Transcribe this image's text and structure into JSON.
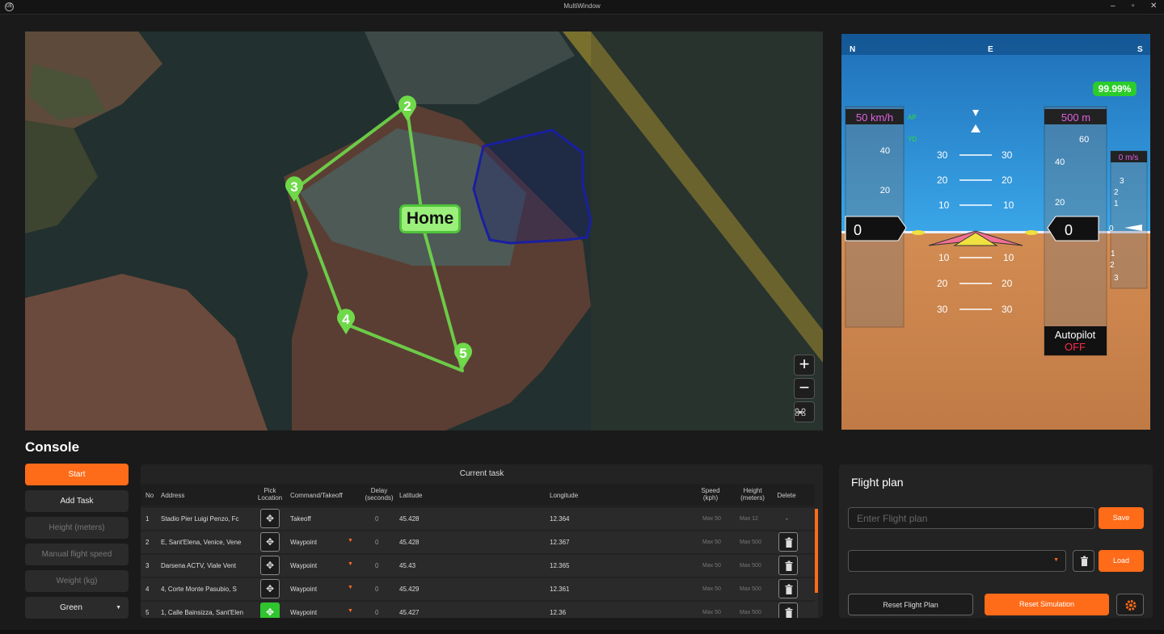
{
  "window": {
    "title": "MultiWindow",
    "logo": "UE",
    "minimize": "–",
    "maximize": "▫",
    "close": "✕"
  },
  "map": {
    "waypoints": [
      {
        "label": "2"
      },
      {
        "label": "3"
      },
      {
        "label": "4"
      },
      {
        "label": "5"
      }
    ],
    "home_label": "Home",
    "zoom_in": "+",
    "zoom_out": "−",
    "recenter_icon": "drone-icon"
  },
  "pfd": {
    "compass": [
      "N",
      "E",
      "S"
    ],
    "battery": "99.99%",
    "speed_readout": "50 km/h",
    "altitude_readout": "500 m",
    "vertical_speed_readout": "0 m/s",
    "ap_flag": "AP",
    "yd_flag": "YD",
    "speed_value": "0",
    "altitude_value": "0",
    "speed_ticks": [
      "40",
      "20"
    ],
    "altitude_ticks": [
      "60",
      "40",
      "20"
    ],
    "vs_ticks_up": [
      "3",
      "2",
      "1"
    ],
    "vs_zero": "0",
    "vs_ticks_down": [
      "1",
      "2",
      "3"
    ],
    "pitch_up": [
      "30",
      "20",
      "10"
    ],
    "pitch_down": [
      "10",
      "20",
      "30"
    ],
    "autopilot_label": "Autopilot",
    "autopilot_state": "OFF",
    "sky_color": "#3aa6e8",
    "ground_color": "#c98550"
  },
  "console": {
    "title": "Console",
    "buttons": {
      "start": "Start",
      "add_task": "Add Task",
      "height": "Height (meters)",
      "manual_speed": "Manual flight speed",
      "weight": "Weight (kg)",
      "color": "Green"
    }
  },
  "task": {
    "title": "Current task",
    "headers": {
      "no": "No",
      "address": "Address",
      "pick1": "Pick",
      "pick2": "Location",
      "command": "Command/Takeoff",
      "delay1": "Delay",
      "delay2": "(seconds)",
      "lat": "Latitude",
      "lon": "Longitude",
      "speed1": "Speed",
      "speed2": "(kph)",
      "height1": "Height",
      "height2": "(meters)",
      "delete": "Delete"
    },
    "rows": [
      {
        "no": "1",
        "address": "Stadio Pier Luigi Penzo, Fc",
        "command": "Takeoff",
        "delay": "0",
        "lat": "45.428",
        "lon": "12.364",
        "speed": "Max 50",
        "height": "Max 12",
        "del": "-"
      },
      {
        "no": "2",
        "address": "E, Sant'Elena, Venice, Vene",
        "command": "Waypoint",
        "delay": "0",
        "lat": "45.428",
        "lon": "12.367",
        "speed": "Max 50",
        "height": "Max 500",
        "del": ""
      },
      {
        "no": "3",
        "address": "Darsena ACTV, Viale Vent",
        "command": "Waypoint",
        "delay": "0",
        "lat": "45.43",
        "lon": "12.365",
        "speed": "Max 50",
        "height": "Max 500",
        "del": ""
      },
      {
        "no": "4",
        "address": "4, Corte Monte Pasubio, S",
        "command": "Waypoint",
        "delay": "0",
        "lat": "45.429",
        "lon": "12.361",
        "speed": "Max 50",
        "height": "Max 500",
        "del": ""
      },
      {
        "no": "5",
        "address": "1, Calle Bainsizza, Sant'Elen",
        "command": "Waypoint",
        "delay": "0",
        "lat": "45.427",
        "lon": "12.36",
        "speed": "Max 50",
        "height": "Max 500",
        "del": ""
      }
    ]
  },
  "flight_plan": {
    "title": "Flight plan",
    "input_placeholder": "Enter Flight plan",
    "save": "Save",
    "load": "Load",
    "reset_plan": "Reset Flight Plan",
    "reset_sim": "Reset Simulation"
  },
  "colors": {
    "accent": "#fe6b19",
    "route": "#6fd94a",
    "zone": "#1a1fa0",
    "active_pick": "#2fc52f"
  }
}
